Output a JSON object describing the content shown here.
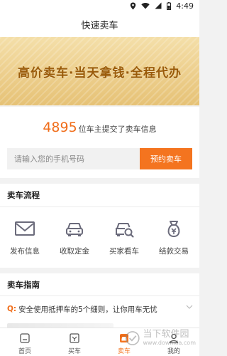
{
  "status_bar": {
    "time": "4:49"
  },
  "header": {
    "title": "快速卖车"
  },
  "banner": {
    "slogan": "高价卖车·当天拿钱·全程代办"
  },
  "submit": {
    "count": "4895",
    "count_suffix": "位车主提交了卖车信息",
    "phone_placeholder": "请输入您的手机号码",
    "button_label": "预约卖车"
  },
  "process": {
    "title": "卖车流程",
    "steps": [
      {
        "label": "发布信息",
        "icon": "envelope-icon"
      },
      {
        "label": "收取定金",
        "icon": "car-icon"
      },
      {
        "label": "买家看车",
        "icon": "car-inspect-icon"
      },
      {
        "label": "结款交易",
        "icon": "money-bag-icon"
      }
    ]
  },
  "guide": {
    "title": "卖车指南",
    "items": [
      {
        "prefix": "Q:",
        "text": "安全使用抵押车的5个细则，让你用车无忧"
      }
    ]
  },
  "tabbar": {
    "active": "卖车",
    "tabs": [
      {
        "label": "首页",
        "icon": "home-icon"
      },
      {
        "label": "买车",
        "icon": "buy-car-icon"
      },
      {
        "label": "卖车",
        "icon": "sell-car-icon"
      },
      {
        "label": "我的",
        "icon": "profile-icon"
      }
    ]
  },
  "watermark": {
    "name": "当下软件园",
    "url": "www.downxia.com"
  },
  "colors": {
    "accent": "#f4741f",
    "banner_text": "#9a5b0a",
    "icon_gray": "#6b6b7b"
  }
}
